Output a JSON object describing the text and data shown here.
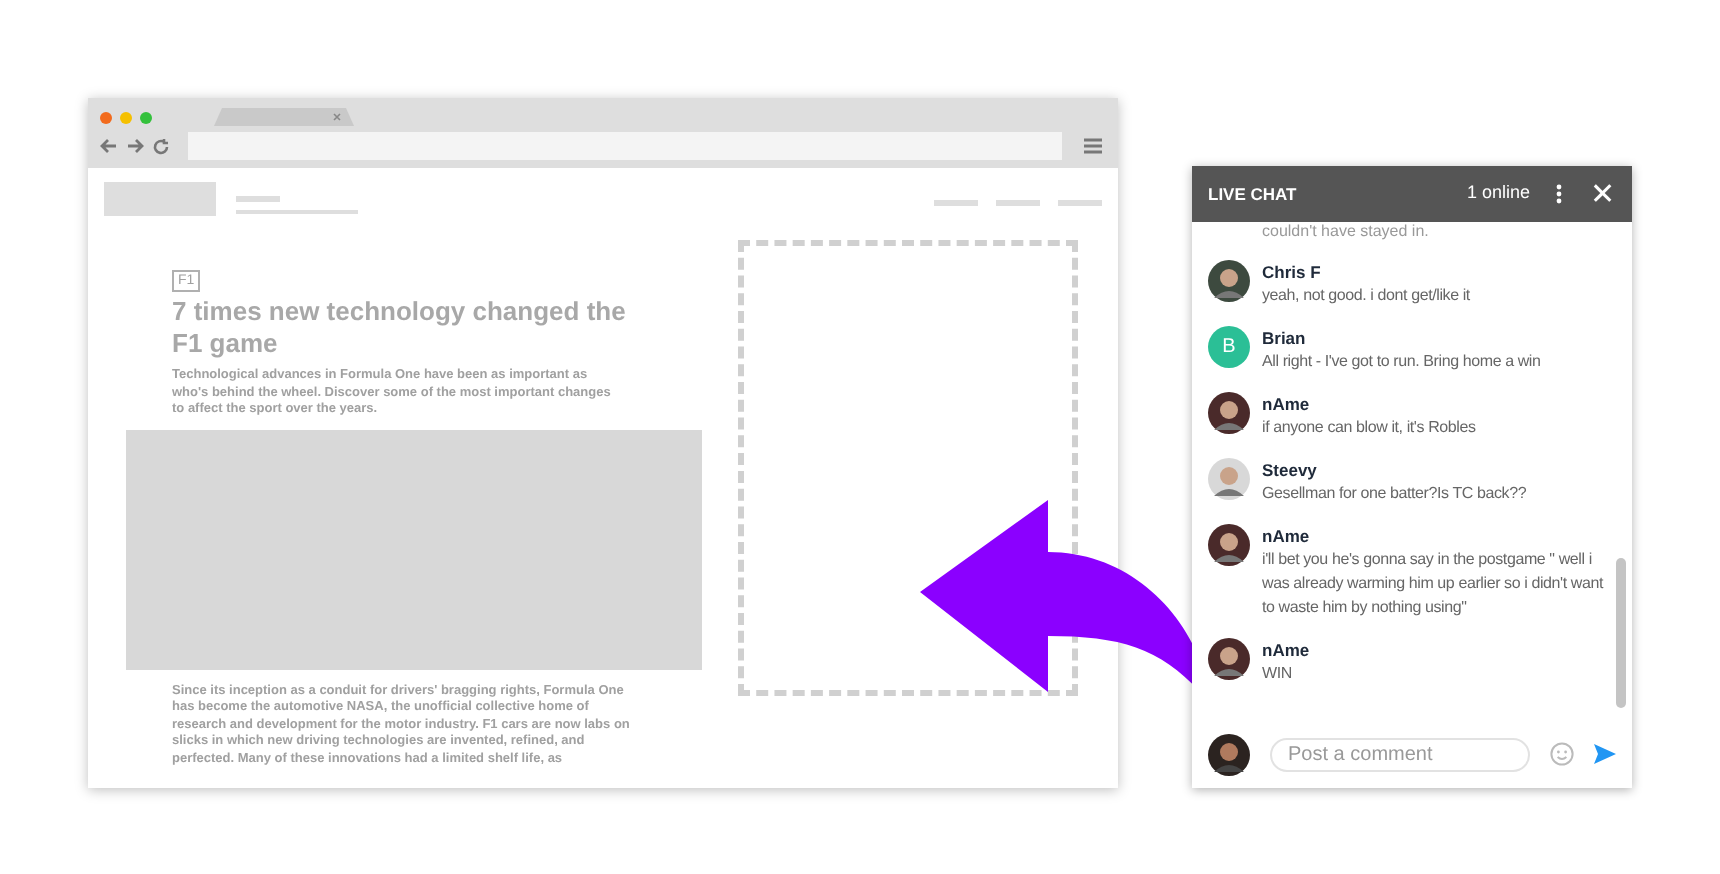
{
  "article": {
    "tag": "F1",
    "title": "7 times new technology changed the F1 game",
    "subtitle": "Technological advances in Formula One have been as important as who's behind the wheel. Discover some of the most important changes to affect the sport over the years.",
    "body": "Since its inception as a conduit for drivers' bragging rights, Formula One has become the automotive NASA, the unofficial collective home of research and development for the motor industry. F1 cars are now labs on slicks in which new driving technologies are invented, refined, and perfected. Many of these innovations had a limited shelf life, as"
  },
  "chat": {
    "title": "LIVE CHAT",
    "online": "1 online",
    "close": "✕",
    "earlier": "couldn't have stayed in.",
    "messages": [
      {
        "name": "Chris F",
        "text": "yeah, not good. i dont get/like it",
        "avatar": {
          "kind": "photo",
          "color": "#3d4a3f"
        }
      },
      {
        "name": "Brian",
        "text": "All right - I've got to run. Bring home a win",
        "avatar": {
          "kind": "letter",
          "letter": "B",
          "color": "#2bbf96"
        }
      },
      {
        "name": "nAme",
        "text": "if anyone can blow it, it's Robles",
        "avatar": {
          "kind": "photo",
          "color": "#4a2a2a"
        }
      },
      {
        "name": "Steevy",
        "text": "Gesellman for one batter?Is TC back??",
        "avatar": {
          "kind": "photo",
          "color": "#d8d8d8"
        }
      },
      {
        "name": "nAme",
        "text": "i'll bet you he's gonna say in the postgame \" well i was already warming him up earlier so i didn't want to waste him by nothing using\"",
        "avatar": {
          "kind": "photo",
          "color": "#4a2a2a"
        }
      },
      {
        "name": "nAme",
        "text": "WIN",
        "avatar": {
          "kind": "photo",
          "color": "#4a2a2a"
        }
      }
    ],
    "composer": {
      "placeholder": "Post a comment"
    }
  }
}
